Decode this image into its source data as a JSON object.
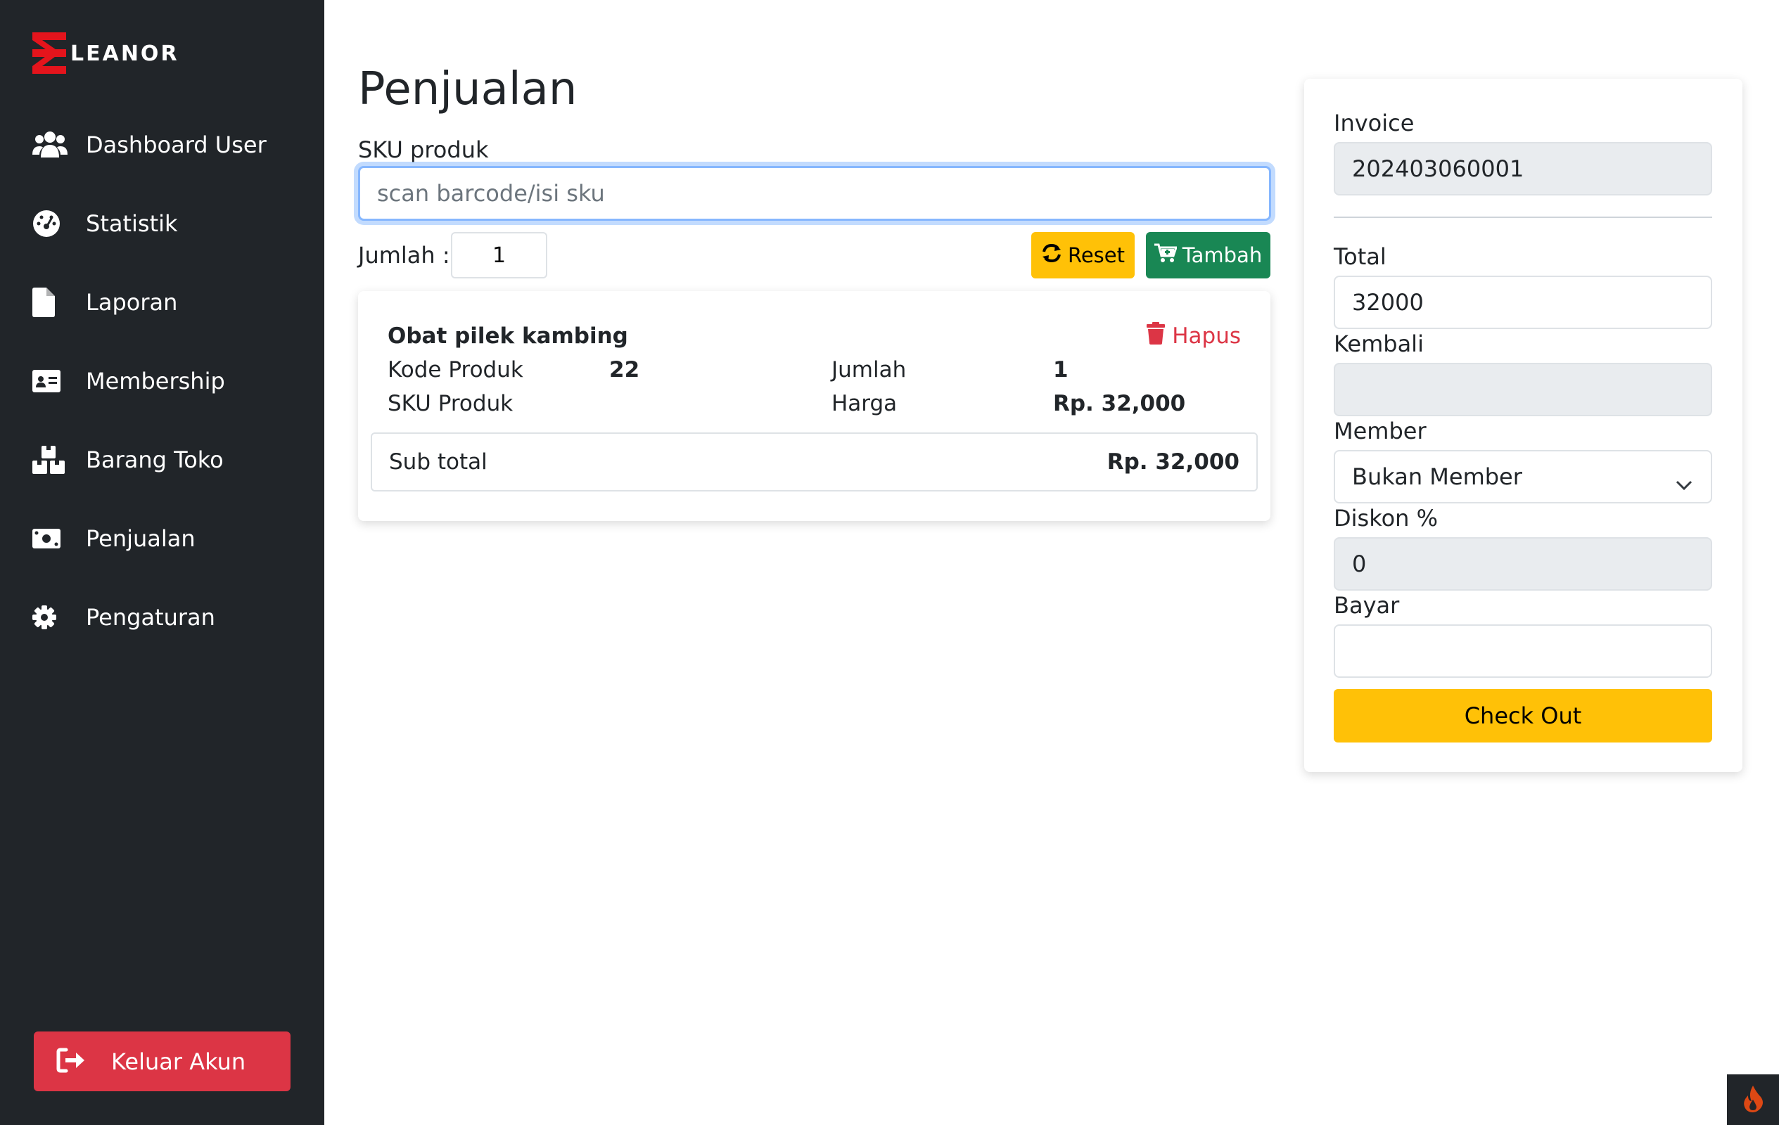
{
  "brand": {
    "logo_text": "LEANOR",
    "accent_color": "#e4141c"
  },
  "sidebar": {
    "items": [
      {
        "label": "Dashboard User",
        "icon": "users-icon"
      },
      {
        "label": "Statistik",
        "icon": "gauge-icon"
      },
      {
        "label": "Laporan",
        "icon": "file-icon"
      },
      {
        "label": "Membership",
        "icon": "id-card-icon"
      },
      {
        "label": "Barang Toko",
        "icon": "boxes-icon"
      },
      {
        "label": "Penjualan",
        "icon": "money-icon"
      },
      {
        "label": "Pengaturan",
        "icon": "gear-icon"
      }
    ],
    "logout_label": "Keluar Akun"
  },
  "main": {
    "title": "Penjualan",
    "sku_label": "SKU produk",
    "sku_placeholder": "scan barcode/isi sku",
    "jumlah_label": "Jumlah :",
    "jumlah_value": "1",
    "reset_label": "Reset",
    "tambah_label": "Tambah"
  },
  "cart": {
    "item_name": "Obat pilek kambing",
    "hapus_label": "Hapus",
    "kode_label": "Kode Produk",
    "kode_value": "22",
    "sku_label": "SKU Produk",
    "sku_value": "",
    "jumlah_label": "Jumlah",
    "jumlah_value": "1",
    "harga_label": "Harga",
    "harga_value": "Rp. 32,000",
    "subtotal_label": "Sub total",
    "subtotal_value": "Rp. 32,000"
  },
  "invoice": {
    "invoice_label": "Invoice",
    "invoice_value": "202403060001",
    "total_label": "Total",
    "total_value": "32000",
    "kembali_label": "Kembali",
    "kembali_value": "",
    "member_label": "Member",
    "member_value": "Bukan Member",
    "diskon_label": "Diskon %",
    "diskon_value": "0",
    "bayar_label": "Bayar",
    "bayar_value": "",
    "checkout_label": "Check Out"
  },
  "colors": {
    "sidebar_bg": "#212529",
    "danger": "#dc3545",
    "warning": "#ffc107",
    "success": "#198754"
  }
}
